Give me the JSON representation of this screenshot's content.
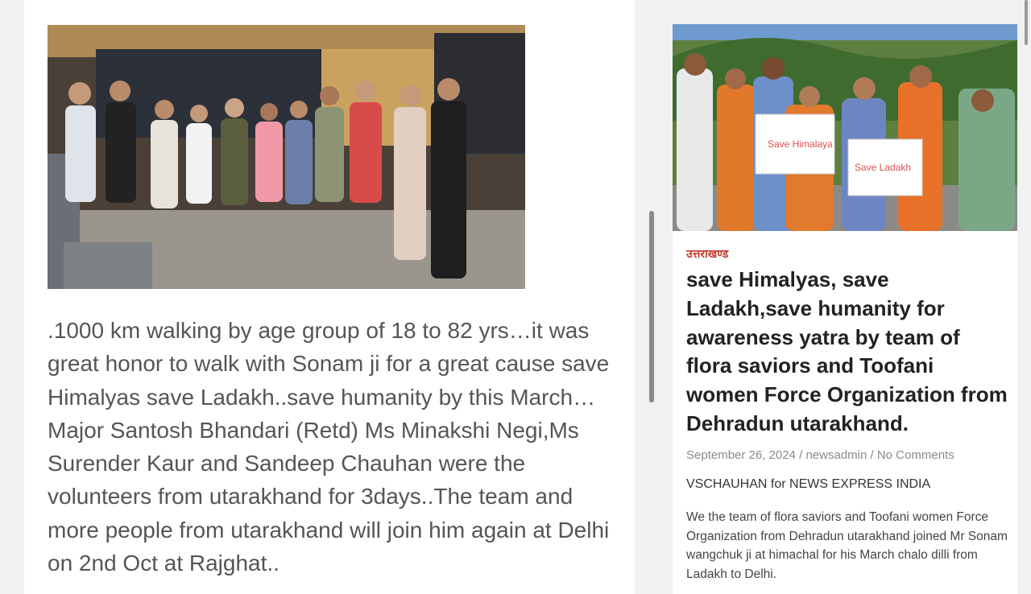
{
  "post": {
    "body_text": ".1000 km walking by age group of 18 to 82 yrs…it was great honor to walk with Sonam ji for a great cause save Himalyas save Ladakh..save humanity by this March…Major Santosh Bhandari (Retd) Ms Minakshi Negi,Ms Surender Kaur and Sandeep Chauhan were the volunteers from utarakhand for 3days..The team and more people from utarakhand will join him again at Delhi on 2nd Oct at Rajghat.."
  },
  "card": {
    "category": "उत्तराखण्ड",
    "title": "save Himalyas, save Ladakh,save humanity for awareness yatra by team of flora saviors and Toofani women Force Organization from Dehradun utarakhand.",
    "date": "September 26, 2024",
    "author": "newsadmin",
    "comments": "No Comments",
    "separator": " / ",
    "byline": "VSCHAUHAN for NEWS EXPRESS INDIA",
    "excerpt": "We the team of flora saviors and Toofani women Force Organization from Dehradun utarakhand joined Mr Sonam wangchuk ji at himachal for his March chalo dilli from Ladakh to Delhi.",
    "banner_left": "Save Himalaya",
    "banner_right": "Save Ladakh"
  },
  "colors": {
    "category": "#c0392b",
    "title": "#222222",
    "body": "#555555"
  }
}
